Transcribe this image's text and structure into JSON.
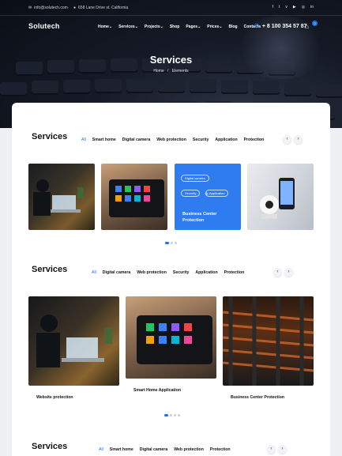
{
  "topbar": {
    "email": "info@solutech.com",
    "address": "658 Lane Drive st. California",
    "socials": [
      "facebook-icon",
      "twitter-icon",
      "vimeo-icon",
      "youtube-icon",
      "github-icon",
      "linkedin-icon"
    ],
    "social_glyphs": [
      "f",
      "t",
      "v",
      "▶",
      "◎",
      "in"
    ]
  },
  "nav": {
    "logo": "Solutech",
    "menu": [
      "Home",
      "Services",
      "Projects",
      "Shop",
      "Pages",
      "Prices",
      "Blog",
      "Contacts"
    ],
    "menu_dropdown": [
      true,
      true,
      true,
      false,
      true,
      true,
      false,
      false
    ],
    "phone": "+ 8 100 354 57 87",
    "cart_count": "0"
  },
  "hero": {
    "title": "Services",
    "breadcrumb_home": "Home",
    "breadcrumb_sep": "/",
    "breadcrumb_current": "Elements"
  },
  "sections": [
    {
      "title": "Services",
      "filters": [
        "All",
        "Smart home",
        "Digital camera",
        "Web protection",
        "Security",
        "Application",
        "Protection"
      ],
      "prev": "‹",
      "next": "›",
      "blue_card": {
        "tags": [
          "Digital camera",
          "Security",
          "Application"
        ],
        "title_line1": "Business Center",
        "title_line2": "Protection"
      }
    },
    {
      "title": "Services",
      "filters": [
        "All",
        "Digital camera",
        "Web protection",
        "Security",
        "Application",
        "Protection"
      ],
      "prev": "‹",
      "next": "›",
      "captions": [
        "Website protection",
        "Smart Home Application",
        "Business Center Protection"
      ]
    },
    {
      "title": "Services",
      "filters": [
        "All",
        "Smart home",
        "Digital camera",
        "Web protection",
        "Protection"
      ],
      "prev": "‹",
      "next": "›"
    }
  ],
  "colors": {
    "accent": "#1a73e8",
    "blue_card": "#2f7cf0",
    "hero_dark": "#0b0e16"
  }
}
